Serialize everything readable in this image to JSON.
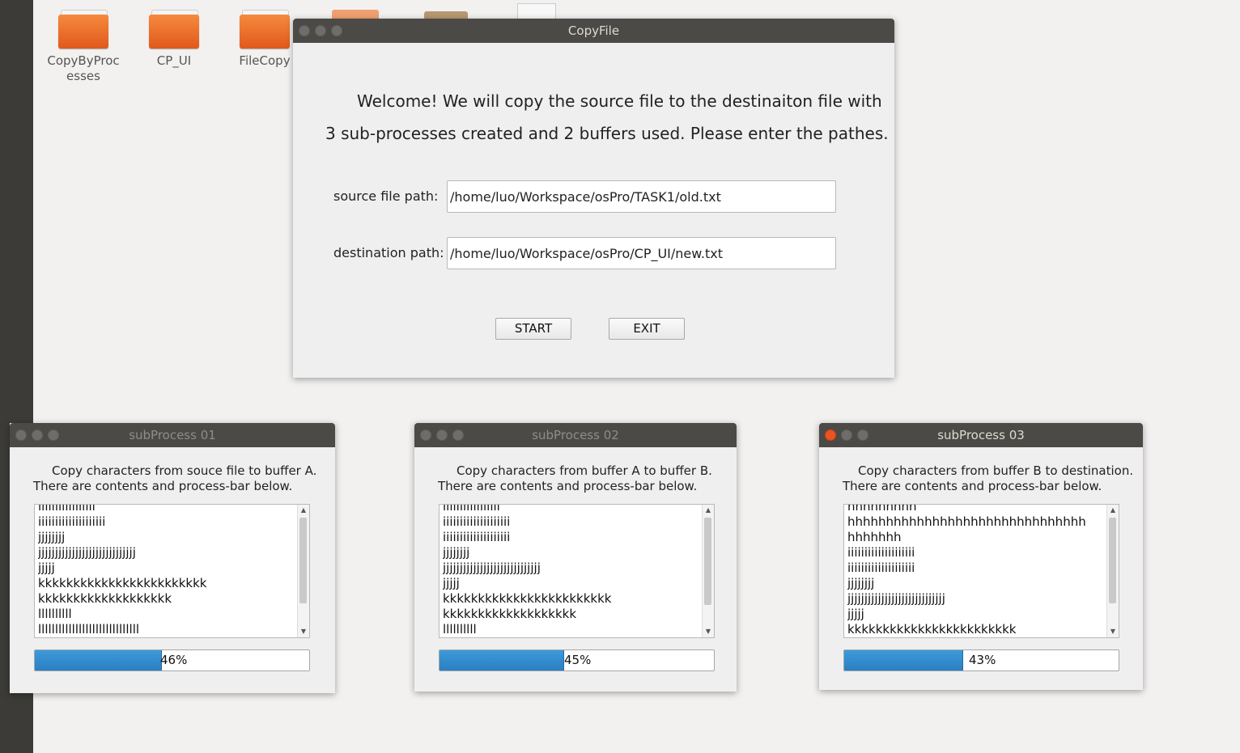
{
  "desktop": {
    "icons": [
      {
        "label": "CopyByProcesses"
      },
      {
        "label": "CP_UI"
      },
      {
        "label": "FileCopy"
      }
    ]
  },
  "main_window": {
    "title": "CopyFile",
    "welcome_line1": "Welcome! We will copy the source file to the destinaiton file with",
    "welcome_line2": "3 sub-processes created and 2 buffers used. Please enter the pathes.",
    "source_label": "source file path:",
    "source_value": "/home/luo/Workspace/osPro/TASK1/old.txt",
    "dest_label": "destination path:",
    "dest_value": "/home/luo/Workspace/osPro/CP_UI/new.txt",
    "start_label": "START",
    "exit_label": "EXIT"
  },
  "subprocesses": [
    {
      "title": "subProcess 01",
      "line1": "Copy characters from souce file to buffer A.",
      "line2": "There are contents and process-bar below.",
      "content": [
        "iiiiiiiiiiiiiiiii",
        "iiiiiiiiiiiiiiiiiiii",
        "jjjjjjjj",
        "jjjjjjjjjjjjjjjjjjjjjjjjjjjjj",
        "jjjjj",
        "kkkkkkkkkkkkkkkkkkkkkkkk",
        "kkkkkkkkkkkkkkkkkkk",
        "llllllllll",
        "llllllllllllllllllllllllllllll"
      ],
      "progress": 46,
      "progress_label": "46%",
      "active": false
    },
    {
      "title": "subProcess 02",
      "line1": "Copy characters from buffer A to buffer B.",
      "line2": "There are contents and process-bar below.",
      "content": [
        "iiiiiiiiiiiiiiiii",
        "iiiiiiiiiiiiiiiiiiii",
        "iiiiiiiiiiiiiiiiiiii",
        "jjjjjjjj",
        "jjjjjjjjjjjjjjjjjjjjjjjjjjjjj",
        "jjjjj",
        "kkkkkkkkkkkkkkkkkkkkkkkk",
        "kkkkkkkkkkkkkkkkkkk",
        "llllllllll"
      ],
      "progress": 45,
      "progress_label": "45%",
      "active": false
    },
    {
      "title": "subProcess 03",
      "line1": "Copy characters from buffer B to destination.",
      "line2": "There are contents and process-bar below.",
      "content": [
        "hhhhhhhhh",
        "hhhhhhhhhhhhhhhhhhhhhhhhhhhhhhh",
        "hhhhhhh",
        "iiiiiiiiiiiiiiiiiiii",
        "iiiiiiiiiiiiiiiiiiii",
        "jjjjjjjj",
        "jjjjjjjjjjjjjjjjjjjjjjjjjjjjj",
        "jjjjj",
        "kkkkkkkkkkkkkkkkkkkkkkkk"
      ],
      "progress": 43,
      "progress_label": "43%",
      "active": true
    }
  ],
  "colors": {
    "progress_fill": "#2f8bd0",
    "close_active": "#e95420",
    "titlebar": "#4b4a46"
  }
}
